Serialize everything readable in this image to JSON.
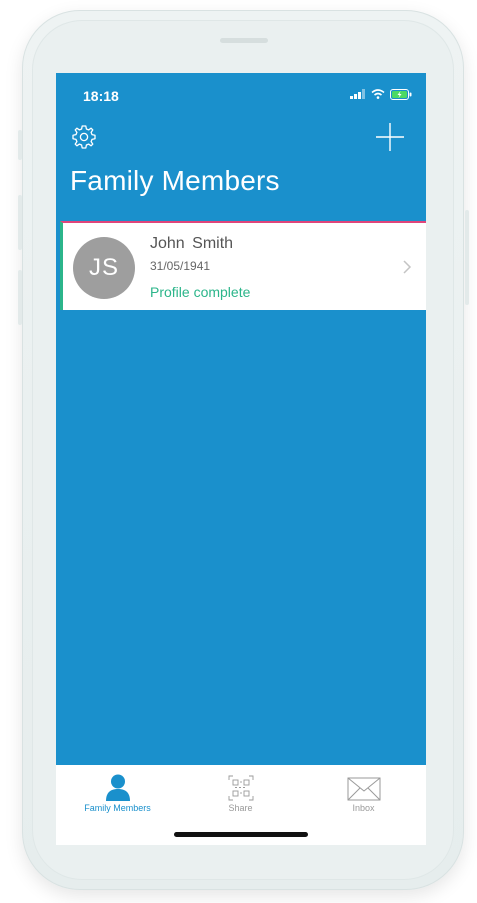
{
  "status_bar": {
    "time": "18:18"
  },
  "header": {
    "title": "Family Members"
  },
  "members": [
    {
      "initials": "JS",
      "name": "John  Smith",
      "dob": "31/05/1941",
      "status": "Profile complete"
    }
  ],
  "tabs": [
    {
      "label": "Family Members",
      "icon": "person-icon",
      "active": true
    },
    {
      "label": "Share",
      "icon": "qr-code-icon",
      "active": false
    },
    {
      "label": "Inbox",
      "icon": "envelope-icon",
      "active": false
    }
  ],
  "colors": {
    "screen_background": "#1a90cc",
    "accent_green": "#2bb58a",
    "accent_pink": "#e0457b",
    "tab_active": "#1a90cc",
    "tab_inactive": "#9a9a9a"
  }
}
